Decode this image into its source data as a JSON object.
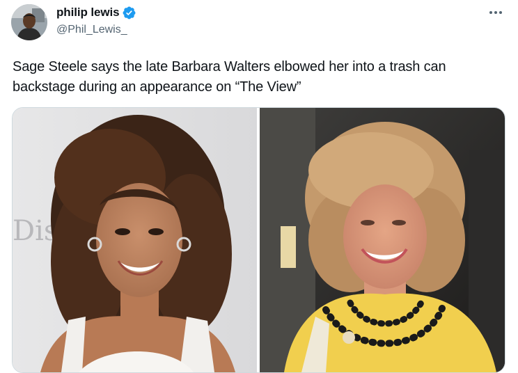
{
  "author": {
    "display_name": "philip lewis",
    "handle": "@Phil_Lewis_",
    "verified": true,
    "avatar_icon": "profile-photo"
  },
  "tweet": {
    "text": "Sage Steele says the late Barbara Walters elbowed her into a trash can backstage during an appearance on “The View”",
    "more_icon": "more-horizontal-icon"
  },
  "media": {
    "left_photo": {
      "backdrop_text": "Dis"
    },
    "right_photo": {}
  },
  "colors": {
    "text": "#0f1419",
    "secondary": "#536471",
    "verified": "#1d9bf0",
    "border": "#cfd9de"
  }
}
